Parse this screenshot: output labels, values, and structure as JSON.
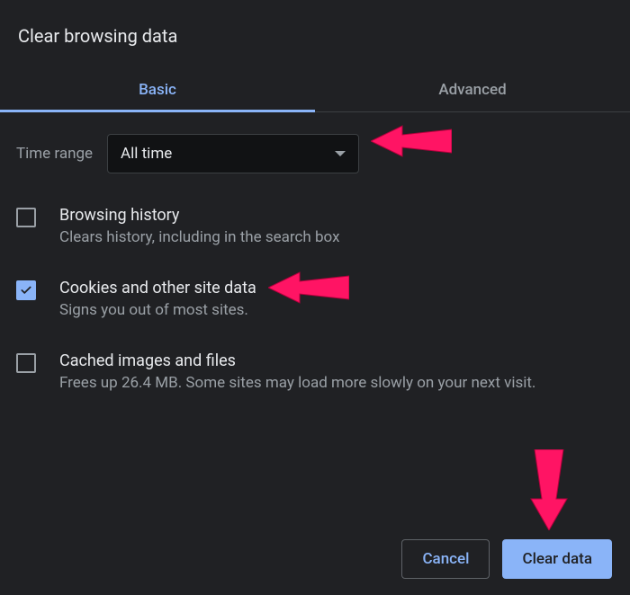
{
  "title": "Clear browsing data",
  "tabs": {
    "basic": "Basic",
    "advanced": "Advanced"
  },
  "timeRange": {
    "label": "Time range",
    "value": "All time"
  },
  "options": [
    {
      "title": "Browsing history",
      "desc": "Clears history, including in the search box",
      "checked": false
    },
    {
      "title": "Cookies and other site data",
      "desc": "Signs you out of most sites.",
      "checked": true
    },
    {
      "title": "Cached images and files",
      "desc": "Frees up 26.4 MB. Some sites may load more slowly on your next visit.",
      "checked": false
    }
  ],
  "buttons": {
    "cancel": "Cancel",
    "clear": "Clear data"
  },
  "colors": {
    "accent": "#8ab4f8",
    "bg": "#202124",
    "muted": "#9aa0a6",
    "arrow": "#ff1464"
  }
}
